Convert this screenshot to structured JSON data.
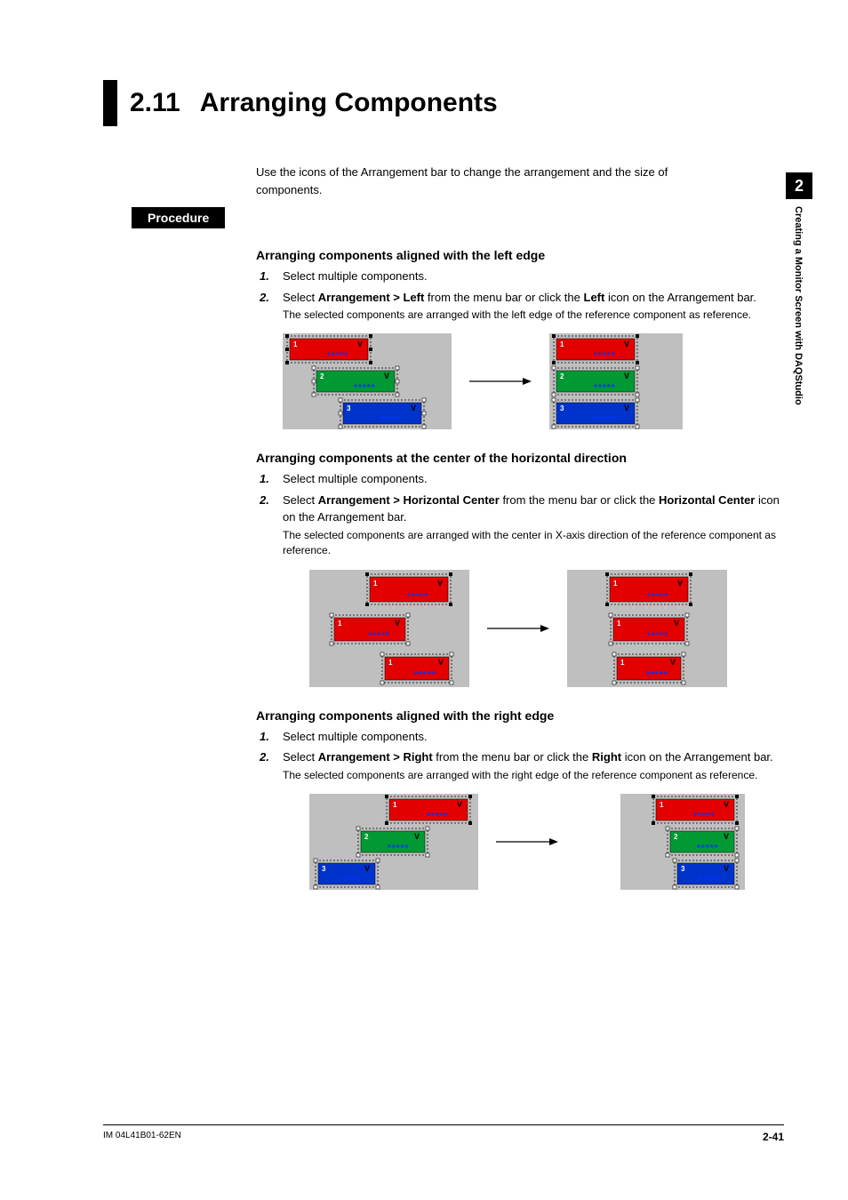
{
  "sidetab": {
    "chapter_num": "2",
    "chapter_title": "Creating a Monitor Screen with DAQStudio"
  },
  "title": {
    "num": "2.11",
    "text": "Arranging Components"
  },
  "intro": "Use the icons of the Arrangement bar to change the arrangement and the size of components.",
  "procedure_label": "Procedure",
  "sections": [
    {
      "heading": "Arranging components aligned with the left edge",
      "steps": [
        {
          "n": "1.",
          "html": "Select multiple components."
        },
        {
          "n": "2.",
          "html": "Select <b>Arrangement > Left</b> from the menu bar or click the <b>Left</b> icon on the Arrangement bar."
        }
      ],
      "note": "The selected components are arranged with the left edge of the reference component as reference."
    },
    {
      "heading": "Arranging components at the center of the horizontal direction",
      "steps": [
        {
          "n": "1.",
          "html": "Select multiple components."
        },
        {
          "n": "2.",
          "html": "Select <b>Arrangement > Horizontal Center</b> from the menu bar or click the <b>Horizontal Center</b> icon on the Arrangement bar."
        }
      ],
      "note": "The selected components are arranged with the center in X-axis direction of the reference component as reference."
    },
    {
      "heading": "Arranging components aligned with the right edge",
      "steps": [
        {
          "n": "1.",
          "html": "Select multiple components."
        },
        {
          "n": "2.",
          "html": "Select <b>Arrangement > Right</b> from the menu bar or click the <b>Right</b> icon on the Arrangement bar."
        }
      ],
      "note": "The selected components are arranged with the right edge of the reference component as reference."
    }
  ],
  "figure_labels": {
    "stars": "*****",
    "v": "V"
  },
  "footer": {
    "doc_id": "IM 04L41B01-62EN",
    "page": "2-41"
  }
}
